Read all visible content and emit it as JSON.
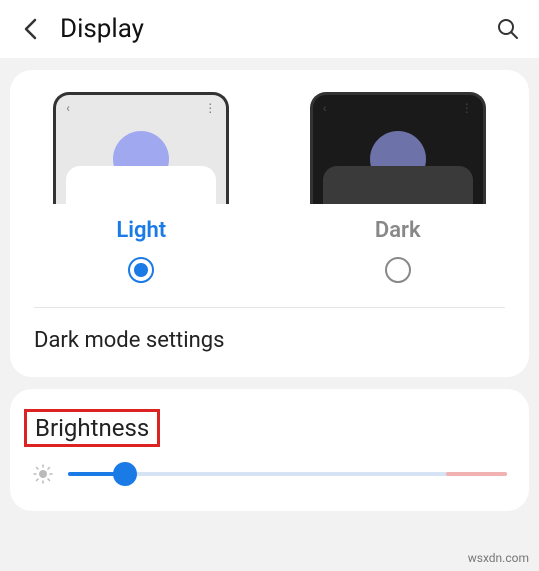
{
  "header": {
    "title": "Display"
  },
  "theme": {
    "options": [
      {
        "label": "Light",
        "selected": true
      },
      {
        "label": "Dark",
        "selected": false
      }
    ],
    "settings_link": "Dark mode settings"
  },
  "brightness": {
    "title": "Brightness",
    "value_percent": 13
  },
  "watermark": "wsxdn.com"
}
